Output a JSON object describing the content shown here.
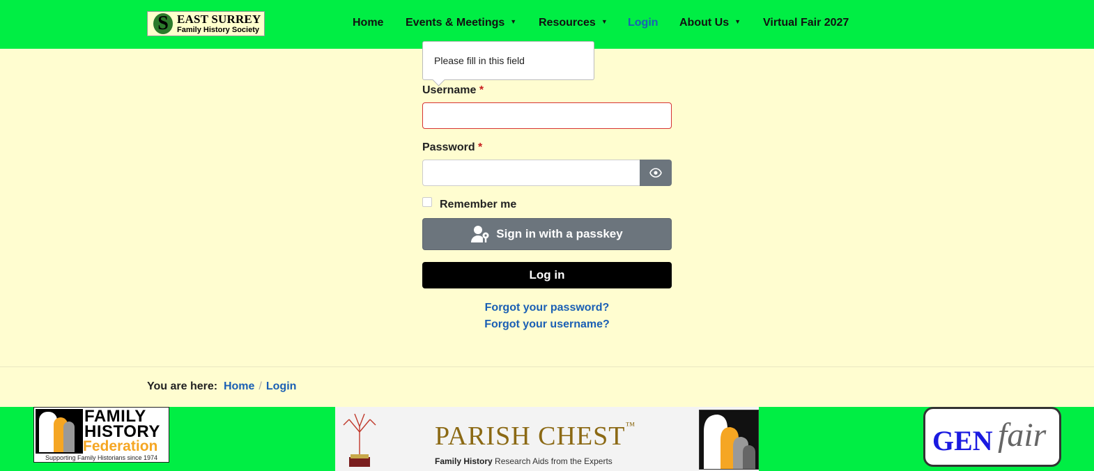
{
  "header": {
    "logo": {
      "line1": "EAST SURREY",
      "line2": "Family History Society"
    },
    "nav": [
      {
        "label": "Home",
        "dropdown": false
      },
      {
        "label": "Events & Meetings",
        "dropdown": true
      },
      {
        "label": "Resources",
        "dropdown": true
      },
      {
        "label": "Login",
        "dropdown": false,
        "active": true
      },
      {
        "label": "About Us",
        "dropdown": true
      },
      {
        "label": "Virtual Fair 2027",
        "dropdown": false
      }
    ]
  },
  "tooltip": {
    "text": "Please fill in this field"
  },
  "form": {
    "username_label": "Username",
    "password_label": "Password",
    "required_mark": "*",
    "remember_label": "Remember me",
    "passkey_button": "Sign in with a passkey",
    "login_button": "Log in",
    "forgot_password": "Forgot your password?",
    "forgot_username": "Forgot your username?",
    "username_value": "",
    "password_value": ""
  },
  "breadcrumb": {
    "prefix": "You are here:",
    "items": [
      "Home",
      "Login"
    ],
    "separator": "/"
  },
  "footer": {
    "fhf": {
      "line1": "FAMILY",
      "line2": "HISTORY",
      "line3": "Federation",
      "tagline": "Supporting Family Historians since 1974"
    },
    "parish_chest": {
      "title": "PARISH CHEST",
      "tm": "™",
      "sub_bold": "Family History",
      "sub_rest": " Research Aids from the Experts"
    },
    "genfair": {
      "gen": "GEN",
      "fair": "fair"
    }
  },
  "colors": {
    "brand_green": "#00ee44",
    "background": "#fffdd0",
    "link_blue": "#1a5fb4",
    "required_red": "#c81e1e",
    "secondary_gray": "#6c757d"
  }
}
